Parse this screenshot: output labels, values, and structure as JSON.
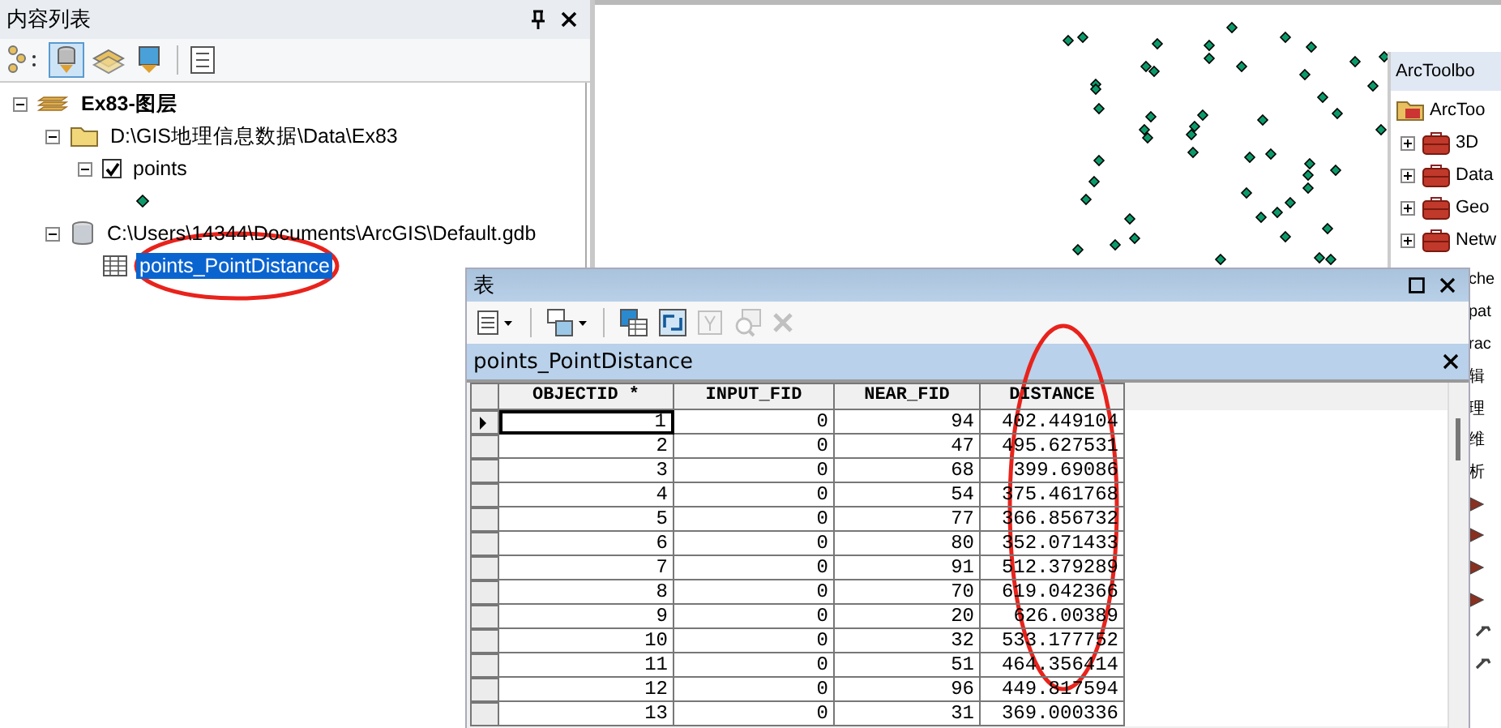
{
  "toc": {
    "title": "内容列表",
    "tree": [
      {
        "label": "Ex83-图层",
        "kind": "dataframe",
        "expanded": true,
        "selected": false,
        "children": [
          {
            "label": "D:\\GIS地理信息数据\\Data\\Ex83",
            "kind": "folder",
            "expanded": true,
            "selected": false,
            "children": [
              {
                "label": "points",
                "kind": "layer",
                "expanded": true,
                "checked": true,
                "selected": false
              }
            ]
          },
          {
            "label": "C:\\Users\\14344\\Documents\\ArcGIS\\Default.gdb",
            "kind": "gdb",
            "expanded": true,
            "selected": false,
            "children": [
              {
                "label": "points_PointDistance",
                "kind": "table",
                "selected": true
              }
            ]
          }
        ]
      }
    ]
  },
  "toolbox": {
    "title": "ArcToolbo",
    "root": "ArcToo",
    "items": [
      {
        "label": "3D",
        "expanded": false
      },
      {
        "label": "Data",
        "expanded": false
      },
      {
        "label": "Geo",
        "expanded": false
      },
      {
        "label": "Netw",
        "expanded": false
      }
    ],
    "cut_rows": [
      {
        "kind": "text",
        "label": "che"
      },
      {
        "kind": "text",
        "label": "pat"
      },
      {
        "kind": "text",
        "label": "rac"
      },
      {
        "kind": "text",
        "label": "辑"
      },
      {
        "kind": "text",
        "label": "理"
      },
      {
        "kind": "text",
        "label": "维"
      },
      {
        "kind": "text",
        "label": "析"
      },
      {
        "kind": "toolset"
      },
      {
        "kind": "toolset"
      },
      {
        "kind": "toolset"
      },
      {
        "kind": "toolset"
      },
      {
        "kind": "tool"
      },
      {
        "kind": "tool"
      }
    ]
  },
  "table_window": {
    "title": "表",
    "tab": "points_PointDistance",
    "columns": [
      "OBJECTID *",
      "INPUT_FID",
      "NEAR_FID",
      "DISTANCE"
    ],
    "rows": [
      {
        "cells": [
          "1",
          "0",
          "94",
          "402.449104"
        ],
        "selected": true
      },
      {
        "cells": [
          "2",
          "0",
          "47",
          "495.627531"
        ],
        "selected": false
      },
      {
        "cells": [
          "3",
          "0",
          "68",
          "399.69086"
        ],
        "selected": false
      },
      {
        "cells": [
          "4",
          "0",
          "54",
          "375.461768"
        ],
        "selected": false
      },
      {
        "cells": [
          "5",
          "0",
          "77",
          "366.856732"
        ],
        "selected": false
      },
      {
        "cells": [
          "6",
          "0",
          "80",
          "352.071433"
        ],
        "selected": false
      },
      {
        "cells": [
          "7",
          "0",
          "91",
          "512.379289"
        ],
        "selected": false
      },
      {
        "cells": [
          "8",
          "0",
          "70",
          "619.042366"
        ],
        "selected": false
      },
      {
        "cells": [
          "9",
          "0",
          "20",
          "626.00389"
        ],
        "selected": false
      },
      {
        "cells": [
          "10",
          "0",
          "32",
          "533.177752"
        ],
        "selected": false
      },
      {
        "cells": [
          "11",
          "0",
          "51",
          "464.356414"
        ],
        "selected": false
      },
      {
        "cells": [
          "12",
          "0",
          "96",
          "449.817594"
        ],
        "selected": false
      },
      {
        "cells": [
          "13",
          "0",
          "31",
          "369.000336"
        ],
        "selected": false
      }
    ]
  }
}
